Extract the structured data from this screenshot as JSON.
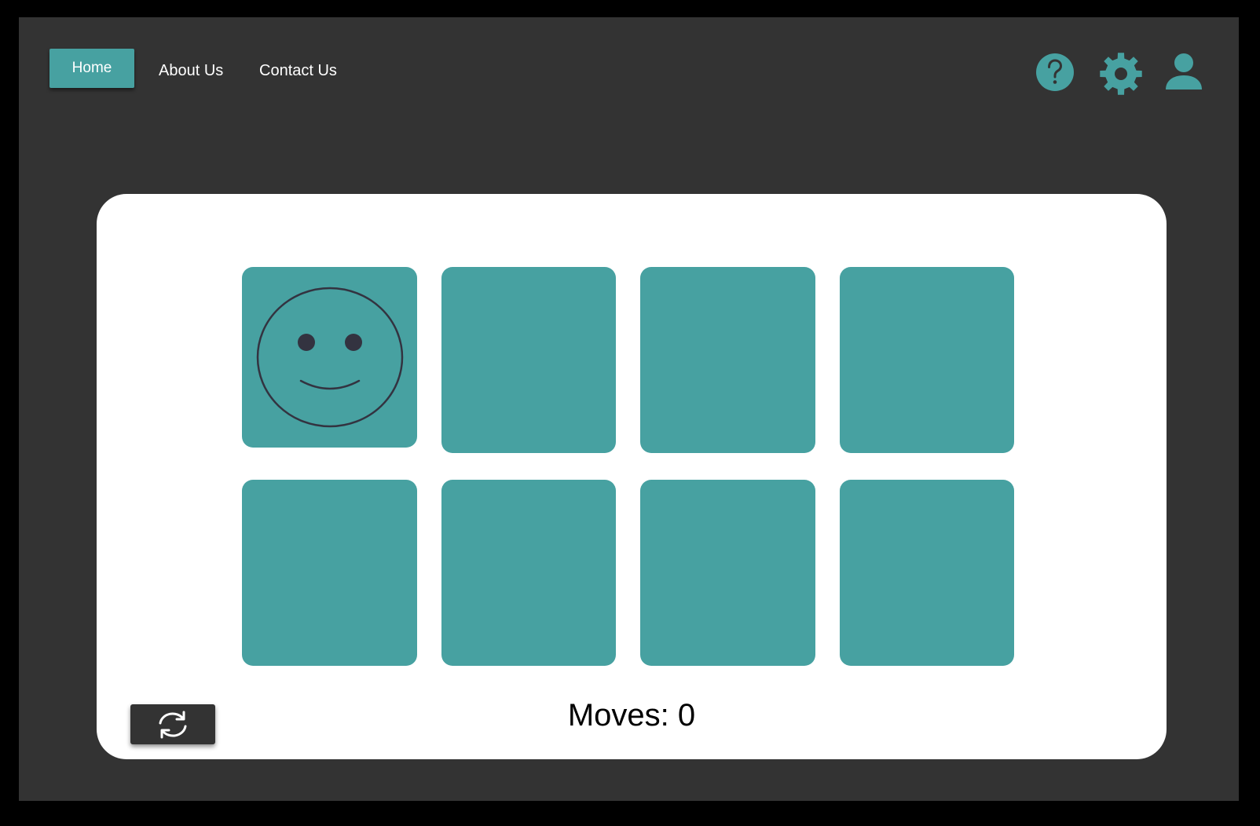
{
  "nav": {
    "home_label": "Home",
    "about_label": "About Us",
    "contact_label": "Contact Us"
  },
  "header_icons": {
    "help": "question-mark-circle",
    "settings": "gear",
    "profile": "user"
  },
  "board": {
    "rows": 2,
    "columns": 4,
    "cards": [
      {
        "state": "revealed",
        "face": "smiley-face"
      },
      {
        "state": "hidden"
      },
      {
        "state": "hidden"
      },
      {
        "state": "hidden"
      },
      {
        "state": "hidden"
      },
      {
        "state": "hidden"
      },
      {
        "state": "hidden"
      },
      {
        "state": "hidden"
      }
    ]
  },
  "status": {
    "moves_label": "Moves:",
    "moves_count": "0"
  },
  "controls": {
    "restart_icon": "refresh"
  },
  "colors": {
    "background": "#333333",
    "accent": "#47a1a1",
    "board": "#ffffff",
    "face_stroke": "#333340"
  }
}
